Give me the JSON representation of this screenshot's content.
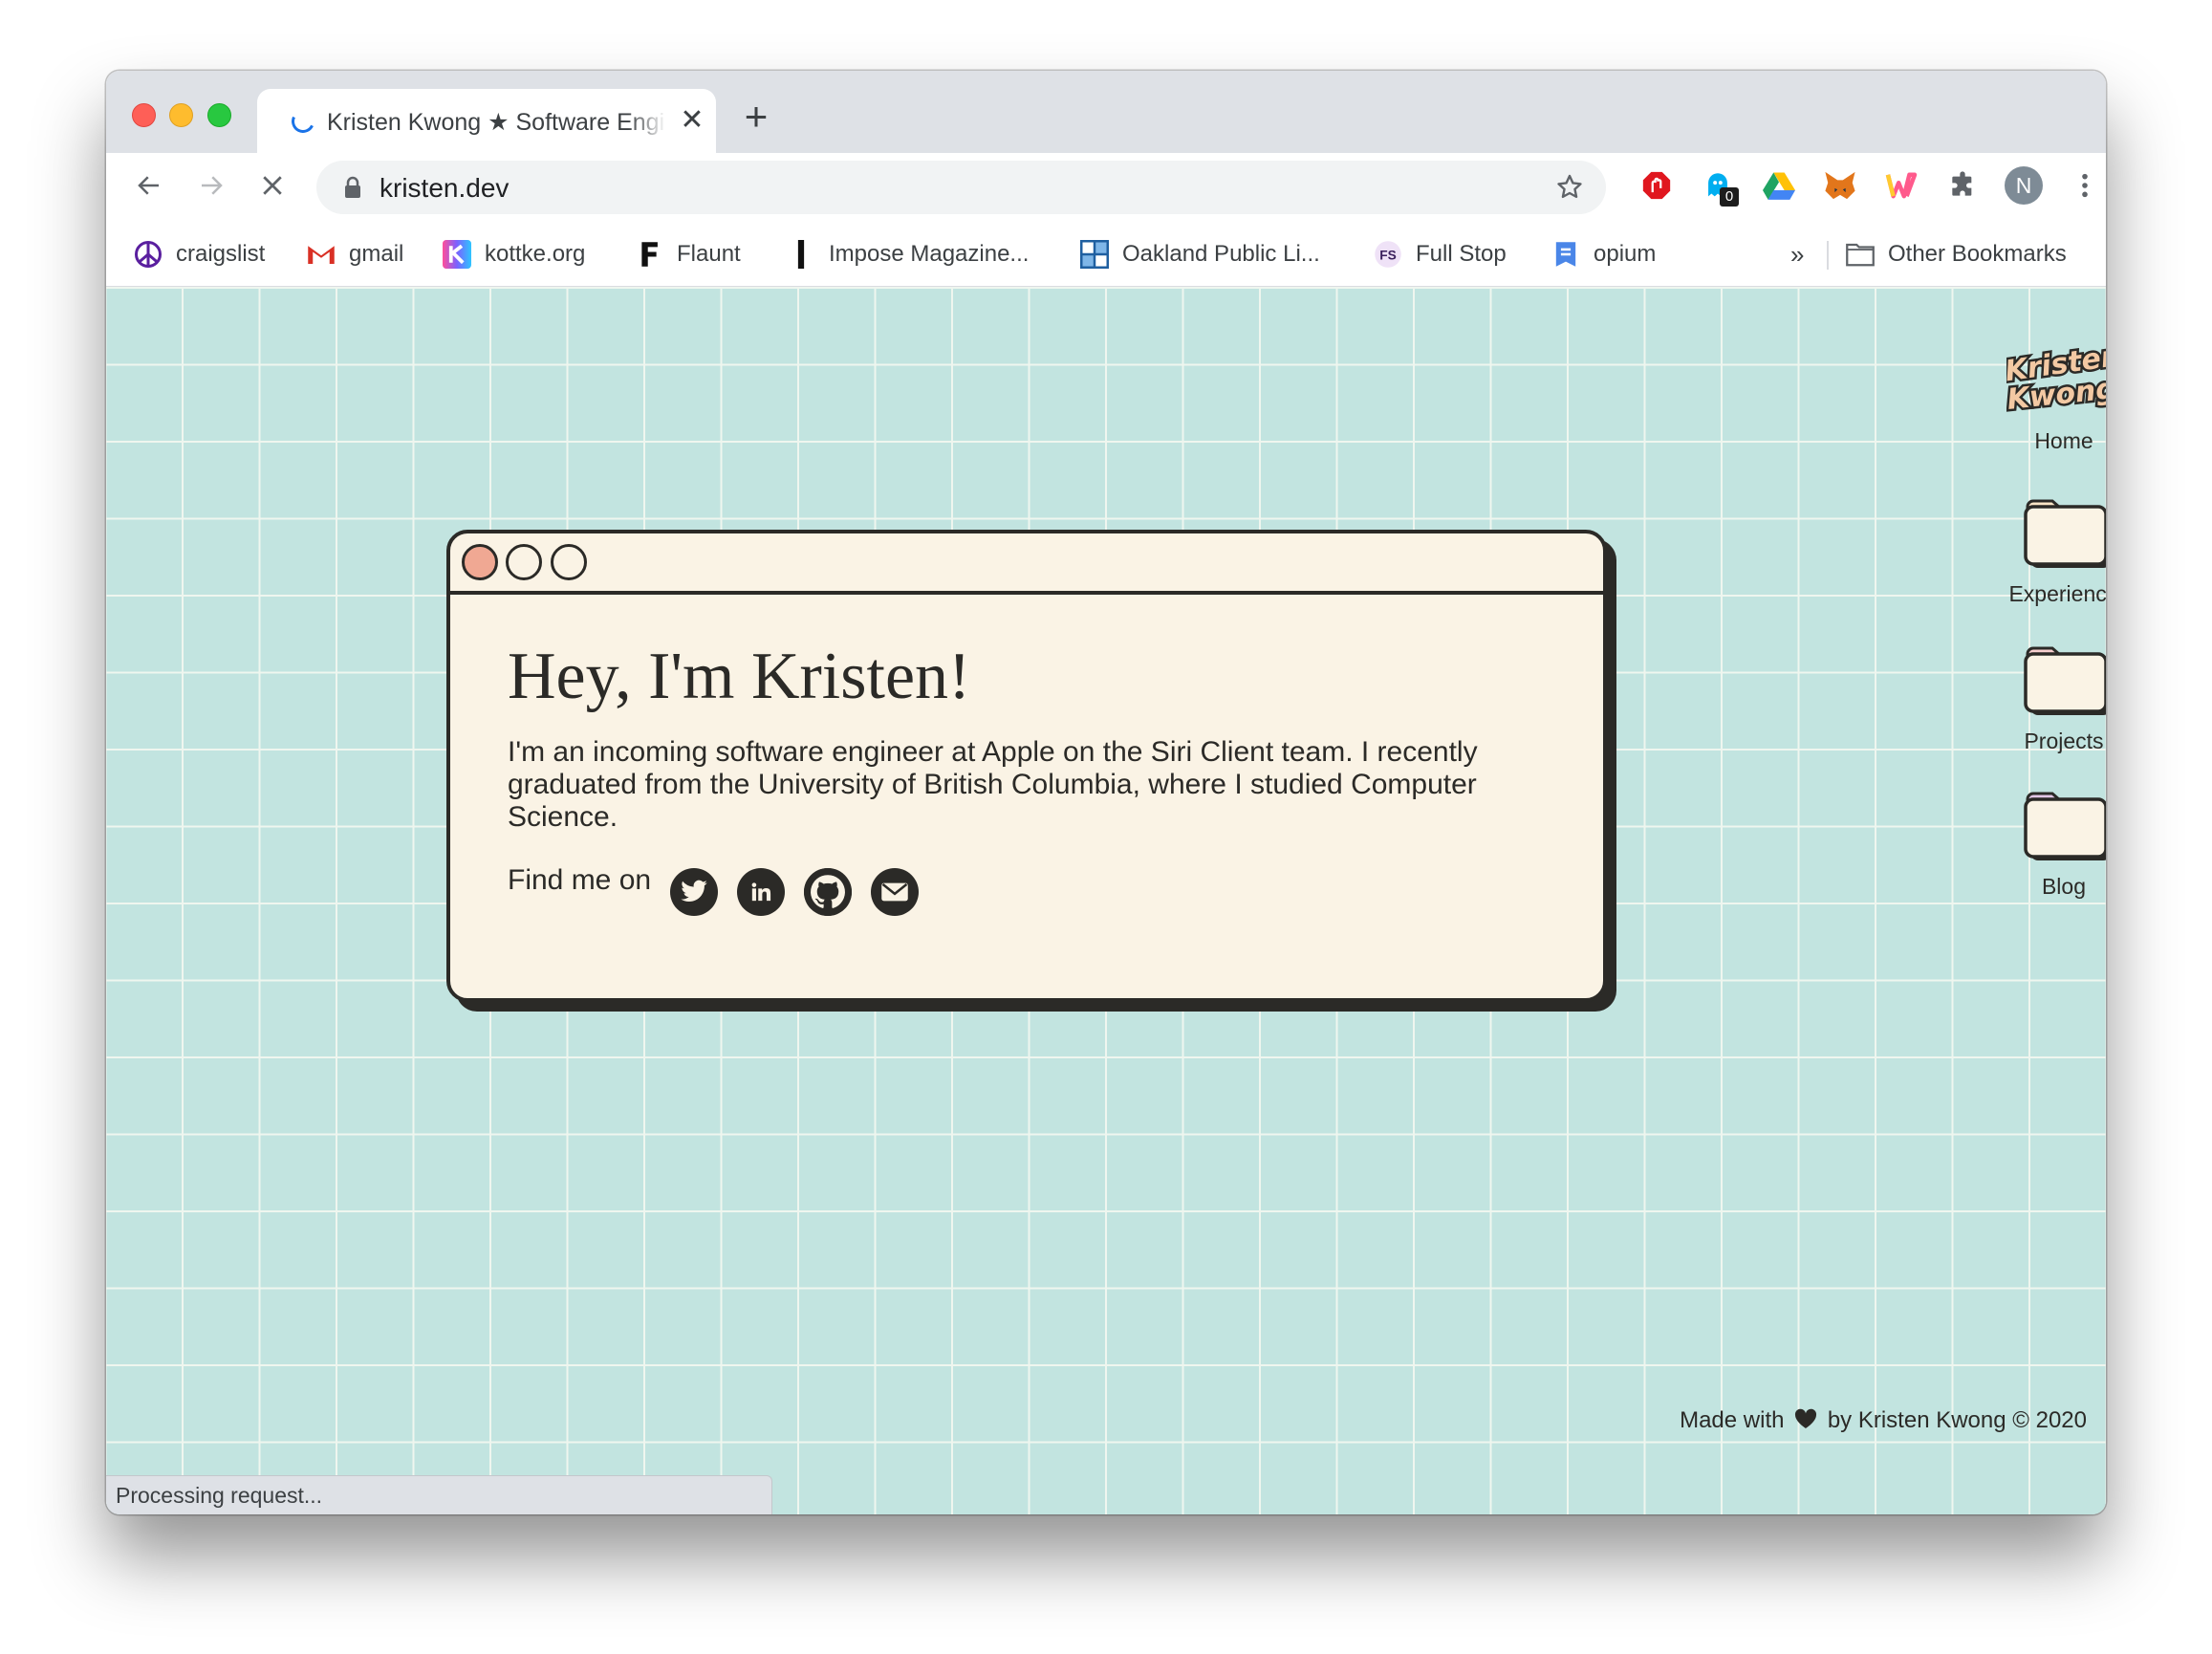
{
  "browser": {
    "tab_title": "Kristen Kwong ★ Software Engineer",
    "tab_close": "✕",
    "new_tab": "+",
    "url": "kristen.dev",
    "extension_badge": "0",
    "profile_initial": "N",
    "status_text": "Processing request..."
  },
  "bookmarks": [
    {
      "label": "craigslist",
      "icon": "peace-icon"
    },
    {
      "label": "gmail",
      "icon": "gmail-icon"
    },
    {
      "label": "kottke.org",
      "icon": "kottke-icon"
    },
    {
      "label": "Flaunt",
      "icon": "flaunt-icon"
    },
    {
      "label": "Impose Magazine...",
      "icon": "impose-icon"
    },
    {
      "label": "Oakland Public Li...",
      "icon": "library-icon"
    },
    {
      "label": "Full Stop",
      "icon": "fullstop-icon"
    },
    {
      "label": "opium",
      "icon": "opium-icon"
    }
  ],
  "bookmarks_more": "»",
  "other_bookmarks": "Other Bookmarks",
  "card": {
    "title": "Hey, I'm Kristen!",
    "text": "I'm an incoming software engineer at Apple on the Siri Client team. I recently graduated from the University of British Columbia, where I studied Computer Science.",
    "find_me": "Find me on",
    "socials": [
      "twitter-icon",
      "linkedin-icon",
      "github-icon",
      "email-icon"
    ]
  },
  "sidebar": {
    "logo_lines": [
      "Kristen",
      "Kwong"
    ],
    "items": [
      {
        "label": "Home"
      },
      {
        "label": "Experience"
      },
      {
        "label": "Projects"
      },
      {
        "label": "Blog"
      }
    ]
  },
  "footer": {
    "prefix": "Made with",
    "suffix": "by Kristen Kwong © 2020"
  },
  "colors": {
    "page_bg": "#c2e4e0",
    "grid_line": "#eff6ef",
    "card_bg": "#faf3e5",
    "ink": "#2b2a27",
    "close_dot": "#f0a893"
  }
}
